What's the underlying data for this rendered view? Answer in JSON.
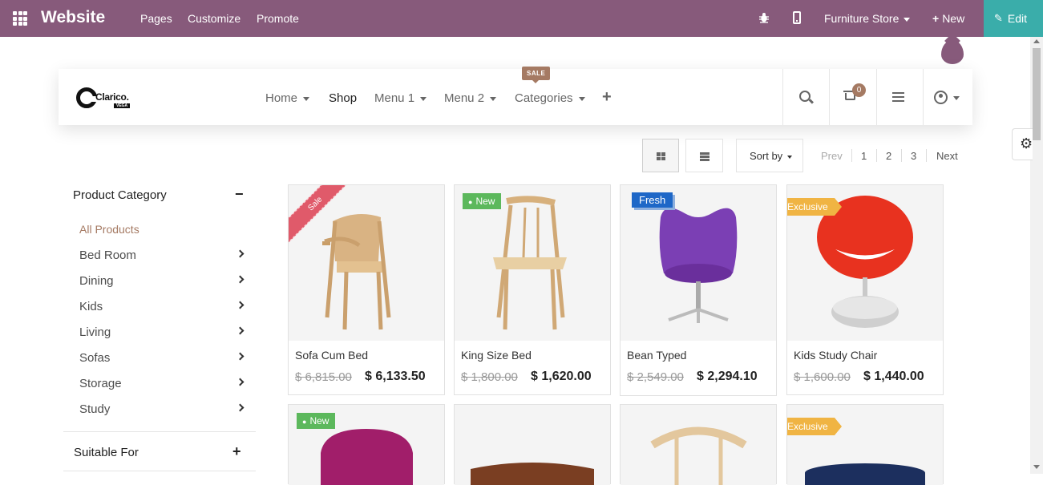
{
  "topbar": {
    "app_name": "Website",
    "menus": [
      "Pages",
      "Customize",
      "Promote"
    ],
    "store": "Furniture Store",
    "new_label": "New",
    "edit_label": "Edit",
    "accent_color": "#875a7b",
    "edit_color": "#3aadaa"
  },
  "header": {
    "logo_text": "Clarico.",
    "logo_sub": "VEGA",
    "nav": [
      {
        "label": "Home",
        "dropdown": true
      },
      {
        "label": "Shop",
        "dropdown": false,
        "active": true
      },
      {
        "label": "Menu 1",
        "dropdown": true
      },
      {
        "label": "Menu 2",
        "dropdown": true
      },
      {
        "label": "Categories",
        "dropdown": true
      }
    ],
    "sale_tag": "SALE",
    "cart_count": "0",
    "icons": [
      "search-icon",
      "cart-icon",
      "filter-icon",
      "user-icon"
    ]
  },
  "toolbar": {
    "sort_label": "Sort by",
    "pager": {
      "prev": "Prev",
      "pages": [
        "1",
        "2",
        "3"
      ],
      "next": "Next"
    }
  },
  "sidebar": {
    "category_title": "Product Category",
    "categories": [
      "All Products",
      "Bed Room",
      "Dining",
      "Kids",
      "Living",
      "Sofas",
      "Storage",
      "Study"
    ],
    "suitable_title": "Suitable For"
  },
  "products": [
    {
      "name": "Sofa Cum Bed",
      "old_price": "$ 6,815.00",
      "price": "$ 6,133.50",
      "badge": "Sale"
    },
    {
      "name": "King Size Bed",
      "old_price": "$ 1,800.00",
      "price": "$ 1,620.00",
      "badge": "New"
    },
    {
      "name": "Bean Typed",
      "old_price": "$ 2,549.00",
      "price": "$ 2,294.10",
      "badge": "Fresh"
    },
    {
      "name": "Kids Study Chair",
      "old_price": "$ 1,600.00",
      "price": "$ 1,440.00",
      "badge": "Exclusive"
    }
  ],
  "products_row2": [
    {
      "badge": "New"
    },
    {
      "badge": ""
    },
    {
      "badge": ""
    },
    {
      "badge": "Exclusive"
    }
  ]
}
